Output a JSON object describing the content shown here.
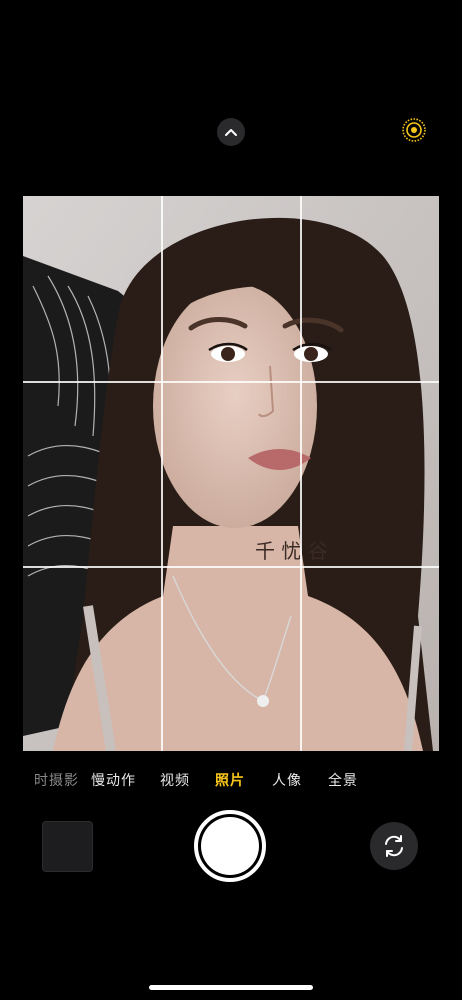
{
  "app": "Camera",
  "top_bar": {
    "expand_icon": "chevron-up-icon",
    "live_photo_icon": "live-photo-icon",
    "live_photo_color": "#f8c51c"
  },
  "viewfinder": {
    "grid": "3x3",
    "overlay_text": "千 忧 谷"
  },
  "modes": [
    {
      "label": "时摄影",
      "state": "faded"
    },
    {
      "label": "慢动作",
      "state": "normal"
    },
    {
      "label": "视频",
      "state": "normal"
    },
    {
      "label": "照片",
      "state": "selected"
    },
    {
      "label": "人像",
      "state": "normal"
    },
    {
      "label": "全景",
      "state": "normal"
    }
  ],
  "controls": {
    "thumbnail": "last-photo-thumbnail",
    "shutter": "shutter-button",
    "flip_icon": "camera-flip-icon"
  },
  "colors": {
    "accent": "#f8c51c",
    "background": "#000000",
    "button_bg": "#2a2a2c"
  }
}
